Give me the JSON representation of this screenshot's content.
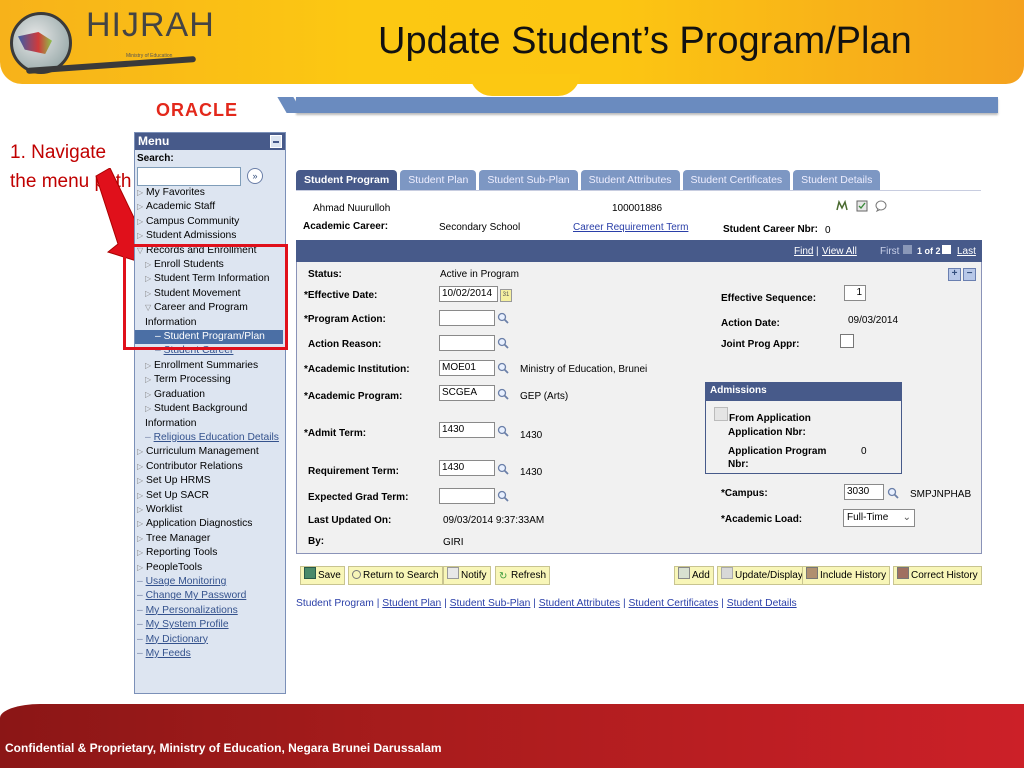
{
  "slide": {
    "title": "Update Student’s Program/Plan",
    "logo_text": "HIJRAH",
    "logo_sub": "Ministry of Education",
    "annotation": "1. Navigate the menu path",
    "footer": "Confidential & Proprietary, Ministry of Education, Negara Brunei Darussalam",
    "colors": {
      "banner": "#fcc812",
      "footer": "#a81c1c",
      "annotation": "#c00000",
      "highlight_box": "#e0101b"
    }
  },
  "oracle": {
    "logo": "ORACLE"
  },
  "menu": {
    "title": "Menu",
    "search_label": "Search:",
    "search_value": "",
    "items": [
      {
        "label": "My Favorites"
      },
      {
        "label": "Academic Staff"
      },
      {
        "label": "Campus Community"
      },
      {
        "label": "Student Admissions"
      },
      {
        "label": "Records and Enrollment"
      },
      {
        "label": "Enroll Students"
      },
      {
        "label": "Student Term Information"
      },
      {
        "label": "Student Movement"
      },
      {
        "label": "Career and Program Information"
      },
      {
        "label": "Student Program/Plan"
      },
      {
        "label": "Student Career"
      },
      {
        "label": "Enrollment Summaries"
      },
      {
        "label": "Term Processing"
      },
      {
        "label": "Graduation"
      },
      {
        "label": "Student Background Information"
      },
      {
        "label": "Religious Education Details"
      },
      {
        "label": "Curriculum Management"
      },
      {
        "label": "Contributor Relations"
      },
      {
        "label": "Set Up HRMS"
      },
      {
        "label": "Set Up SACR"
      },
      {
        "label": "Worklist"
      },
      {
        "label": "Application Diagnostics"
      },
      {
        "label": "Tree Manager"
      },
      {
        "label": "Reporting Tools"
      },
      {
        "label": "PeopleTools"
      },
      {
        "label": "Usage Monitoring"
      },
      {
        "label": "Change My Password"
      },
      {
        "label": "My Personalizations"
      },
      {
        "label": "My System Profile"
      },
      {
        "label": "My Dictionary"
      },
      {
        "label": "My Feeds"
      }
    ]
  },
  "tabs": [
    {
      "label": "Student Program",
      "active": true
    },
    {
      "label": "Student Plan"
    },
    {
      "label": "Student Sub-Plan"
    },
    {
      "label": "Student Attributes"
    },
    {
      "label": "Student Certificates"
    },
    {
      "label": "Student Details"
    }
  ],
  "student": {
    "name": "Ahmad Nuurulloh",
    "id": "100001886",
    "career_label": "Academic Career:",
    "career_value": "Secondary School",
    "career_req_link": "Career Requirement Term",
    "career_nbr_label": "Student Career Nbr:",
    "career_nbr_value": "0"
  },
  "grid_nav": {
    "find": "Find",
    "sep": "|",
    "view_all": "View All",
    "first": "First",
    "position": "1 of 2",
    "last": "Last"
  },
  "form": {
    "status_label": "Status:",
    "status_value": "Active in Program",
    "effective_date_label": "*Effective Date:",
    "effective_date_value": "10/02/2014",
    "program_action_label": "*Program Action:",
    "program_action_value": "",
    "action_reason_label": "Action Reason:",
    "action_reason_value": "",
    "institution_label": "*Academic Institution:",
    "institution_value": "MOE01",
    "institution_desc": "Ministry of Education, Brunei",
    "program_label": "*Academic Program:",
    "program_value": "SCGEA",
    "program_desc": "GEP (Arts)",
    "admit_term_label": "*Admit Term:",
    "admit_term_value": "1430",
    "admit_term_desc": "1430",
    "req_term_label": "Requirement Term:",
    "req_term_value": "1430",
    "req_term_desc": "1430",
    "grad_term_label": "Expected Grad Term:",
    "grad_term_value": "",
    "last_updated_label": "Last Updated On:",
    "last_updated_value": "09/03/2014  9:37:33AM",
    "by_label": "By:",
    "by_value": "GIRI",
    "eff_seq_label": "Effective Sequence:",
    "eff_seq_value": "1",
    "action_date_label": "Action Date:",
    "action_date_value": "09/03/2014",
    "joint_prog_label": "Joint Prog Appr:",
    "campus_label": "*Campus:",
    "campus_value": "3030",
    "campus_desc": "SMPJNPHAB",
    "load_label": "*Academic Load:",
    "load_value": "Full-Time"
  },
  "admissions": {
    "title": "Admissions",
    "from_app": "From Application",
    "app_nbr_label": "Application Nbr:",
    "app_prog_label": "Application Program Nbr:",
    "app_prog_value": "0"
  },
  "buttons": {
    "save": "Save",
    "return": "Return to Search",
    "notify": "Notify",
    "refresh": "Refresh",
    "add": "Add",
    "update": "Update/Display",
    "include": "Include History",
    "correct": "Correct History"
  },
  "bottom_links": [
    "Student Program",
    "Student Plan",
    "Student Sub-Plan",
    "Student Attributes",
    "Student Certificates",
    "Student Details"
  ]
}
